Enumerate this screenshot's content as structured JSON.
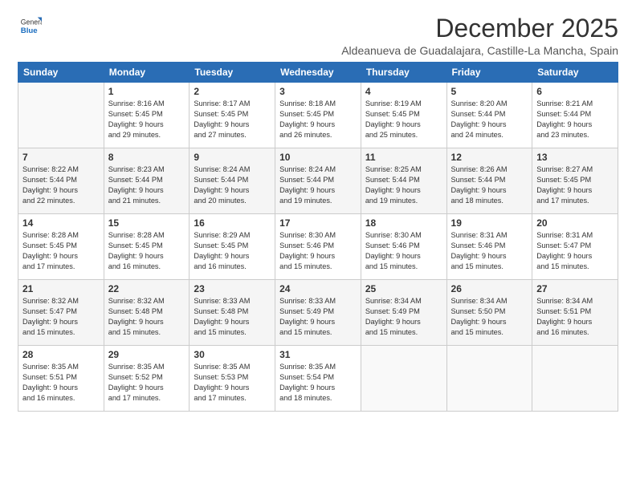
{
  "logo": {
    "general": "General",
    "blue": "Blue"
  },
  "header": {
    "month": "December 2025",
    "location": "Aldeanueva de Guadalajara, Castille-La Mancha, Spain"
  },
  "weekdays": [
    "Sunday",
    "Monday",
    "Tuesday",
    "Wednesday",
    "Thursday",
    "Friday",
    "Saturday"
  ],
  "weeks": [
    [
      {
        "day": "",
        "info": ""
      },
      {
        "day": "1",
        "info": "Sunrise: 8:16 AM\nSunset: 5:45 PM\nDaylight: 9 hours\nand 29 minutes."
      },
      {
        "day": "2",
        "info": "Sunrise: 8:17 AM\nSunset: 5:45 PM\nDaylight: 9 hours\nand 27 minutes."
      },
      {
        "day": "3",
        "info": "Sunrise: 8:18 AM\nSunset: 5:45 PM\nDaylight: 9 hours\nand 26 minutes."
      },
      {
        "day": "4",
        "info": "Sunrise: 8:19 AM\nSunset: 5:45 PM\nDaylight: 9 hours\nand 25 minutes."
      },
      {
        "day": "5",
        "info": "Sunrise: 8:20 AM\nSunset: 5:44 PM\nDaylight: 9 hours\nand 24 minutes."
      },
      {
        "day": "6",
        "info": "Sunrise: 8:21 AM\nSunset: 5:44 PM\nDaylight: 9 hours\nand 23 minutes."
      }
    ],
    [
      {
        "day": "7",
        "info": "Sunrise: 8:22 AM\nSunset: 5:44 PM\nDaylight: 9 hours\nand 22 minutes."
      },
      {
        "day": "8",
        "info": "Sunrise: 8:23 AM\nSunset: 5:44 PM\nDaylight: 9 hours\nand 21 minutes."
      },
      {
        "day": "9",
        "info": "Sunrise: 8:24 AM\nSunset: 5:44 PM\nDaylight: 9 hours\nand 20 minutes."
      },
      {
        "day": "10",
        "info": "Sunrise: 8:24 AM\nSunset: 5:44 PM\nDaylight: 9 hours\nand 19 minutes."
      },
      {
        "day": "11",
        "info": "Sunrise: 8:25 AM\nSunset: 5:44 PM\nDaylight: 9 hours\nand 19 minutes."
      },
      {
        "day": "12",
        "info": "Sunrise: 8:26 AM\nSunset: 5:44 PM\nDaylight: 9 hours\nand 18 minutes."
      },
      {
        "day": "13",
        "info": "Sunrise: 8:27 AM\nSunset: 5:45 PM\nDaylight: 9 hours\nand 17 minutes."
      }
    ],
    [
      {
        "day": "14",
        "info": "Sunrise: 8:28 AM\nSunset: 5:45 PM\nDaylight: 9 hours\nand 17 minutes."
      },
      {
        "day": "15",
        "info": "Sunrise: 8:28 AM\nSunset: 5:45 PM\nDaylight: 9 hours\nand 16 minutes."
      },
      {
        "day": "16",
        "info": "Sunrise: 8:29 AM\nSunset: 5:45 PM\nDaylight: 9 hours\nand 16 minutes."
      },
      {
        "day": "17",
        "info": "Sunrise: 8:30 AM\nSunset: 5:46 PM\nDaylight: 9 hours\nand 15 minutes."
      },
      {
        "day": "18",
        "info": "Sunrise: 8:30 AM\nSunset: 5:46 PM\nDaylight: 9 hours\nand 15 minutes."
      },
      {
        "day": "19",
        "info": "Sunrise: 8:31 AM\nSunset: 5:46 PM\nDaylight: 9 hours\nand 15 minutes."
      },
      {
        "day": "20",
        "info": "Sunrise: 8:31 AM\nSunset: 5:47 PM\nDaylight: 9 hours\nand 15 minutes."
      }
    ],
    [
      {
        "day": "21",
        "info": "Sunrise: 8:32 AM\nSunset: 5:47 PM\nDaylight: 9 hours\nand 15 minutes."
      },
      {
        "day": "22",
        "info": "Sunrise: 8:32 AM\nSunset: 5:48 PM\nDaylight: 9 hours\nand 15 minutes."
      },
      {
        "day": "23",
        "info": "Sunrise: 8:33 AM\nSunset: 5:48 PM\nDaylight: 9 hours\nand 15 minutes."
      },
      {
        "day": "24",
        "info": "Sunrise: 8:33 AM\nSunset: 5:49 PM\nDaylight: 9 hours\nand 15 minutes."
      },
      {
        "day": "25",
        "info": "Sunrise: 8:34 AM\nSunset: 5:49 PM\nDaylight: 9 hours\nand 15 minutes."
      },
      {
        "day": "26",
        "info": "Sunrise: 8:34 AM\nSunset: 5:50 PM\nDaylight: 9 hours\nand 15 minutes."
      },
      {
        "day": "27",
        "info": "Sunrise: 8:34 AM\nSunset: 5:51 PM\nDaylight: 9 hours\nand 16 minutes."
      }
    ],
    [
      {
        "day": "28",
        "info": "Sunrise: 8:35 AM\nSunset: 5:51 PM\nDaylight: 9 hours\nand 16 minutes."
      },
      {
        "day": "29",
        "info": "Sunrise: 8:35 AM\nSunset: 5:52 PM\nDaylight: 9 hours\nand 17 minutes."
      },
      {
        "day": "30",
        "info": "Sunrise: 8:35 AM\nSunset: 5:53 PM\nDaylight: 9 hours\nand 17 minutes."
      },
      {
        "day": "31",
        "info": "Sunrise: 8:35 AM\nSunset: 5:54 PM\nDaylight: 9 hours\nand 18 minutes."
      },
      {
        "day": "",
        "info": ""
      },
      {
        "day": "",
        "info": ""
      },
      {
        "day": "",
        "info": ""
      }
    ]
  ]
}
